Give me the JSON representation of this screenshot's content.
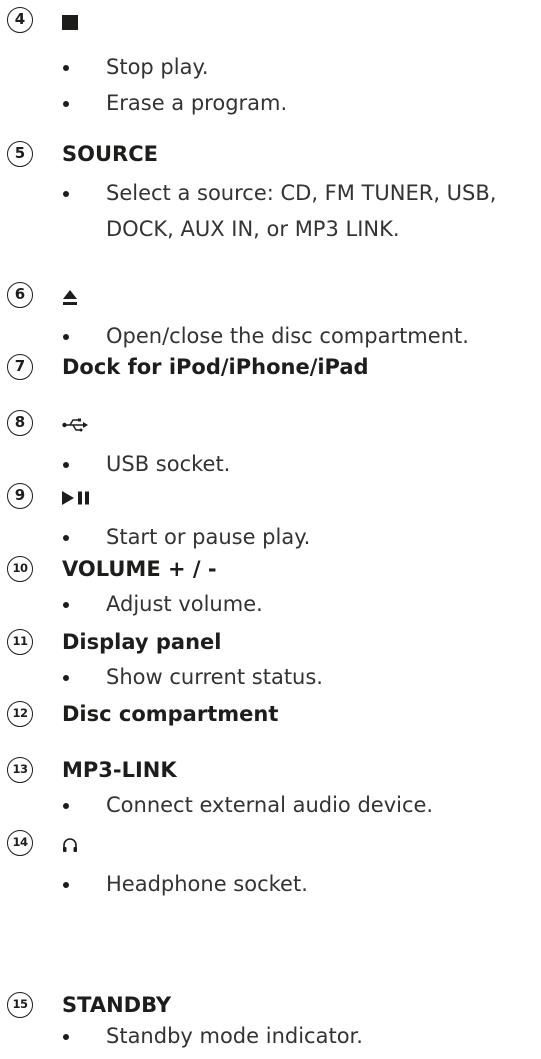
{
  "items": [
    {
      "number": "4",
      "symbol": "stop",
      "bullets": [
        "Stop play.",
        "Erase a program."
      ]
    },
    {
      "number": "5",
      "title": "SOURCE",
      "bullets": [
        "Select a source: CD, FM TUNER, USB, DOCK, AUX IN, or MP3 LINK."
      ]
    },
    {
      "number": "6",
      "symbol": "eject",
      "bullets": [
        "Open/close the disc compartment."
      ]
    },
    {
      "number": "7",
      "title": "Dock for iPod/iPhone/iPad",
      "bullets": []
    },
    {
      "number": "8",
      "symbol": "usb",
      "bullets": [
        "USB socket."
      ]
    },
    {
      "number": "9",
      "symbol": "play-pause",
      "bullets": [
        "Start or pause play."
      ]
    },
    {
      "number": "10",
      "title": "VOLUME + / -",
      "bullets": [
        "Adjust volume."
      ]
    },
    {
      "number": "11",
      "title": "Display panel",
      "bullets": [
        "Show current status."
      ]
    },
    {
      "number": "12",
      "title": "Disc compartment",
      "bullets": []
    },
    {
      "number": "13",
      "title": "MP3-LINK",
      "bullets": [
        "Connect external audio device."
      ]
    },
    {
      "number": "14",
      "symbol": "headphone",
      "bullets": [
        "Headphone socket."
      ]
    },
    {
      "number": "15",
      "title": "STANDBY",
      "bullets": [
        "Standby mode indicator."
      ]
    }
  ]
}
